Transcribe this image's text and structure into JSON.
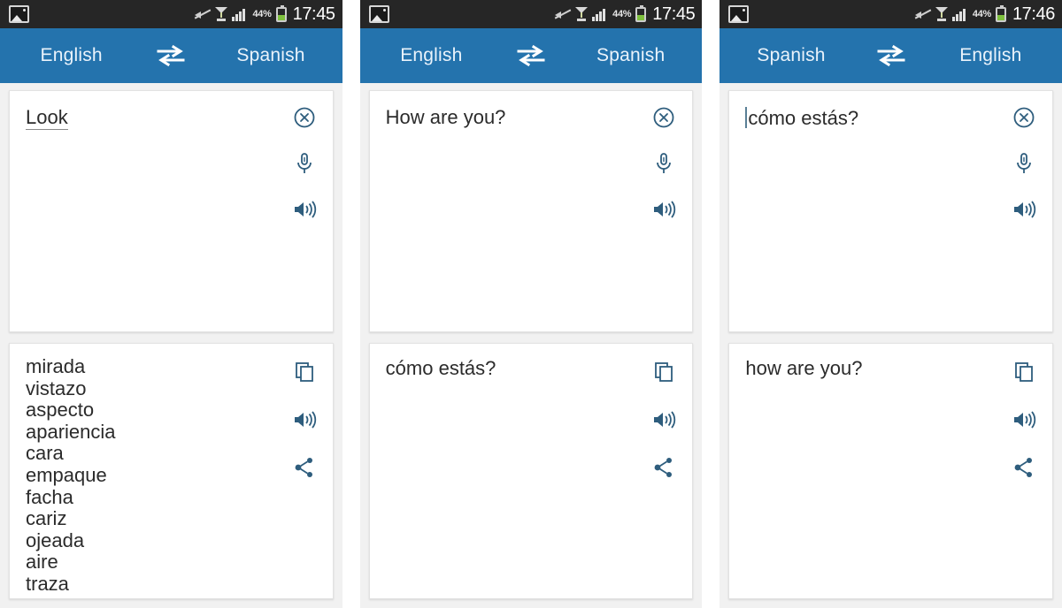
{
  "app": {
    "name": "Translator",
    "accent_color": "#2473ad",
    "icon_color": "#2e5d7d",
    "statusbar_color": "#262626"
  },
  "screens": [
    {
      "statusbar": {
        "gallery_icon": "gallery-icon",
        "mute_icon": "mute-icon",
        "gps_icon": "gps-icon",
        "signal_icon": "signal-bars-icon",
        "battery_percent": "44%",
        "battery_icon": "battery-icon",
        "clock": "17:45"
      },
      "langbar": {
        "source_language": "English",
        "target_language": "Spanish",
        "swap_icon": "swap-arrows-icon"
      },
      "input": {
        "text": "Look",
        "underlined": true,
        "caret": false,
        "clear_icon": "clear-circle-icon",
        "mic_icon": "microphone-icon",
        "speak_icon": "speaker-icon"
      },
      "output": {
        "text": "",
        "words": [
          "mirada",
          "vistazo",
          "aspecto",
          "apariencia",
          "cara",
          "empaque",
          "facha",
          "cariz",
          "ojeada",
          "aire",
          "traza"
        ],
        "copy_icon": "copy-icon",
        "speak_icon": "speaker-icon",
        "share_icon": "share-icon"
      }
    },
    {
      "statusbar": {
        "gallery_icon": "gallery-icon",
        "mute_icon": "mute-icon",
        "gps_icon": "gps-icon",
        "signal_icon": "signal-bars-icon",
        "battery_percent": "44%",
        "battery_icon": "battery-icon",
        "clock": "17:45"
      },
      "langbar": {
        "source_language": "English",
        "target_language": "Spanish",
        "swap_icon": "swap-arrows-icon"
      },
      "input": {
        "text": "How are you?",
        "underlined": false,
        "caret": false,
        "clear_icon": "clear-circle-icon",
        "mic_icon": "microphone-icon",
        "speak_icon": "speaker-icon"
      },
      "output": {
        "text": "cómo estás?",
        "words": [],
        "copy_icon": "copy-icon",
        "speak_icon": "speaker-icon",
        "share_icon": "share-icon"
      }
    },
    {
      "statusbar": {
        "gallery_icon": "gallery-icon",
        "mute_icon": "mute-icon",
        "gps_icon": "gps-icon",
        "signal_icon": "signal-bars-icon",
        "battery_percent": "44%",
        "battery_icon": "battery-icon",
        "clock": "17:46"
      },
      "langbar": {
        "source_language": "Spanish",
        "target_language": "English",
        "swap_icon": "swap-arrows-icon"
      },
      "input": {
        "text": "cómo estás?",
        "underlined": false,
        "caret": true,
        "clear_icon": "clear-circle-icon",
        "mic_icon": "microphone-icon",
        "speak_icon": "speaker-icon"
      },
      "output": {
        "text": "how are you?",
        "words": [],
        "copy_icon": "copy-icon",
        "speak_icon": "speaker-icon",
        "share_icon": "share-icon"
      }
    }
  ]
}
